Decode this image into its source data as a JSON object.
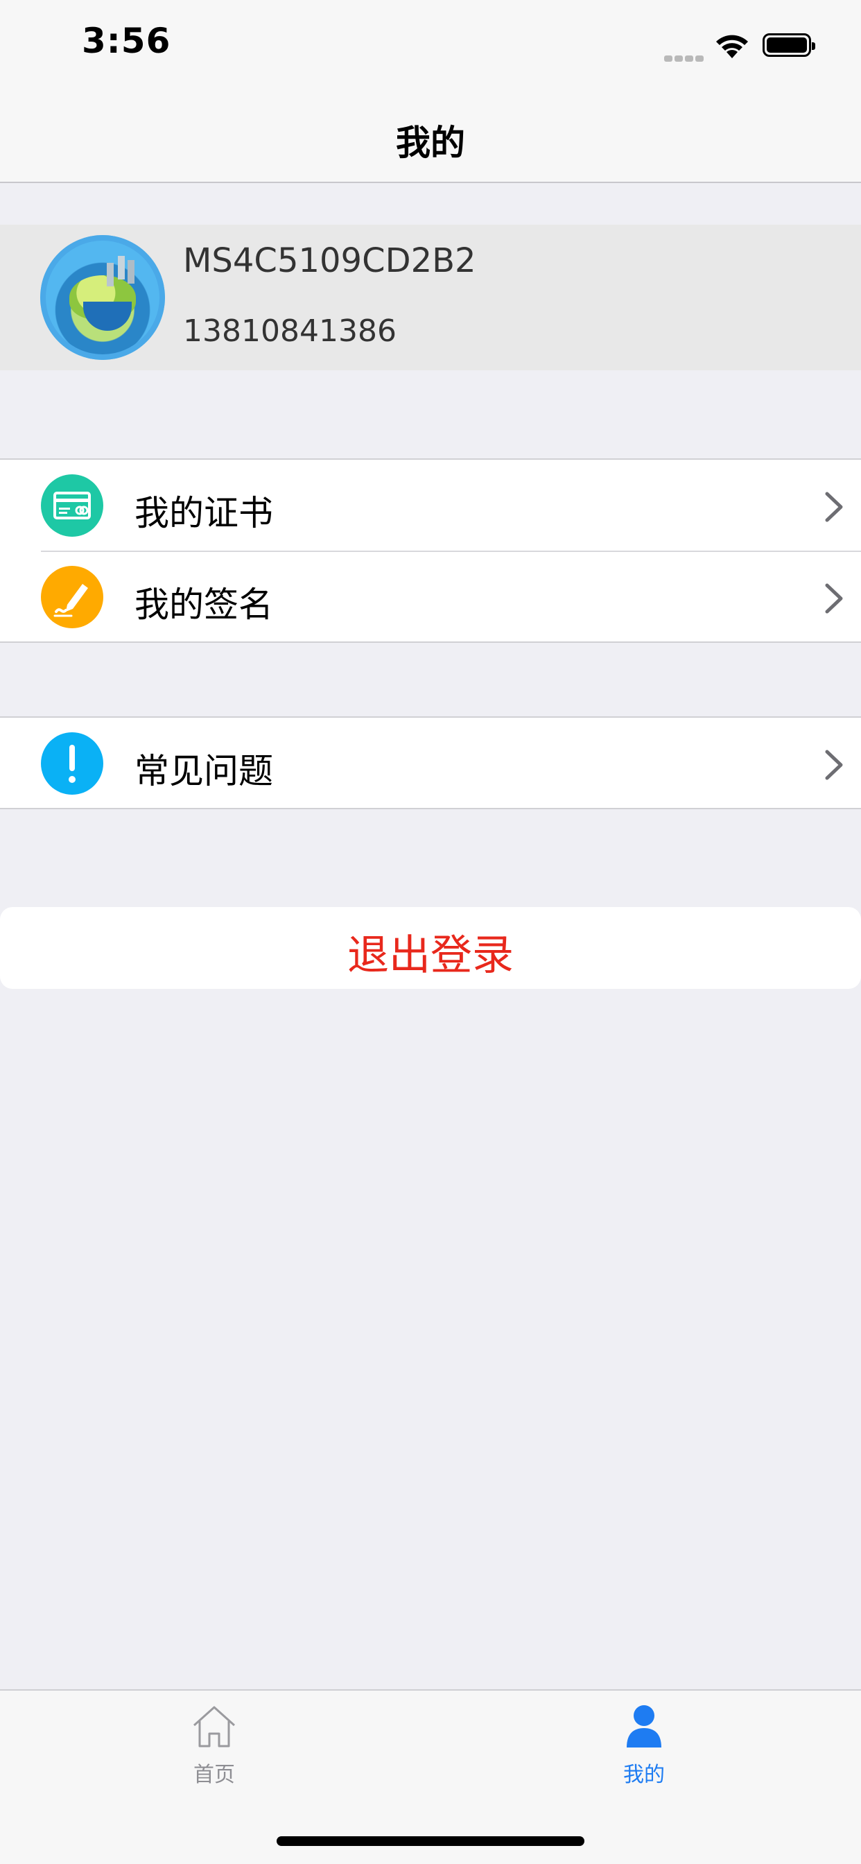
{
  "status_bar": {
    "time": "3:56"
  },
  "nav": {
    "title": "我的"
  },
  "profile": {
    "user_id": "MS4C5109CD2B2",
    "phone": "13810841386"
  },
  "menu_groups": [
    {
      "items": [
        {
          "label": "我的证书",
          "icon": "certificate-icon",
          "color": "#1ec8a5"
        },
        {
          "label": "我的签名",
          "icon": "signature-pen-icon",
          "color": "#ffaa00"
        }
      ]
    },
    {
      "items": [
        {
          "label": "常见问题",
          "icon": "exclamation-icon",
          "color": "#0ab1f5"
        }
      ]
    }
  ],
  "logout": {
    "label": "退出登录",
    "color": "#e8281c"
  },
  "tabbar": {
    "tabs": [
      {
        "label": "首页",
        "icon": "home-icon",
        "active": false,
        "color": "#8e8e93"
      },
      {
        "label": "我的",
        "icon": "person-icon",
        "active": true,
        "color": "#1e7cf2"
      }
    ]
  }
}
